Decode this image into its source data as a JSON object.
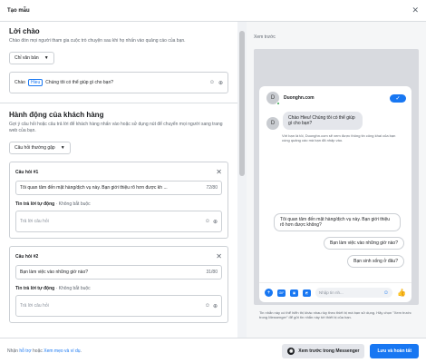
{
  "modal": {
    "title": "Tạo mẫu"
  },
  "greeting": {
    "title": "Lời chào",
    "desc": "Chào đón mọi người tham gia cuộc trò chuyện sau khi họ nhấn vào quảng cáo của bạn.",
    "type_value": "Chỉ văn bản",
    "prefix": "Chào",
    "chip": "Hieu",
    "text": "Chúng tôi có thể giúp gì cho bạn?"
  },
  "actions": {
    "title": "Hành động của khách hàng",
    "desc": "Gợi ý câu hỏi hoặc câu trả lời để khách hàng nhấn vào hoặc sử dụng nút để chuyển mọi người sang trang web của bạn.",
    "type_value": "Câu hỏi thường gặp",
    "questions": [
      {
        "label": "Câu hỏi #1",
        "value": "Tôi quan tâm đến mặt hàng/dịch vụ này. Bạn giới thiệu rõ hơn được kh ...",
        "count": "72/80",
        "auto_label": "Tin trả lời tự động",
        "auto_opt": "· Không bắt buộc",
        "auto_placeholder": "Trả lời câu hỏi"
      },
      {
        "label": "Câu hỏi #2",
        "value": "Bạn làm việc vào những giờ nào?",
        "count": "31/80",
        "auto_label": "Tin trả lời tự động",
        "auto_opt": "· Không bắt buộc",
        "auto_placeholder": "Trả lời câu hỏi"
      }
    ]
  },
  "preview": {
    "label": "Xem trước",
    "page_name": "Duonghn.com",
    "avatar_letter": "D",
    "greeting_bubble": "Chào Hieu! Chúng tôi có thể giúp gì cho bạn?",
    "privacy": "Với bạn là tôi, Duonghn.com sẽ xem được thông tin công khai của bạn cùng quảng cáo mà bạn đã nhấp vào.",
    "faqs": [
      "Tôi quan tâm đến mặt hàng/dịch vụ này. Bạn giới thiệu rõ hơn được không?",
      "Bạn làm việc vào những giờ nào?",
      "Bạn sinh sống ở đâu?"
    ],
    "composer_placeholder": "Nhập tin nh...",
    "footnote": "Tin nhắn này có thể hiển thị khác nhau tùy theo thiết bị mà bạn sử dụng. Hãy chọn \"Xem trước trong Messenger\" để gửi tin nhắn này tới thiết bị của bạn."
  },
  "footer": {
    "help_prefix": "Nhận",
    "help_link1": "hỗ trợ",
    "help_mid": "hoặc",
    "help_link2": "Xem mẹo và ví dụ",
    "help_suffix": ".",
    "preview_button": "Xem trước trong Messenger",
    "save_button": "Lưu và hoàn tất"
  }
}
